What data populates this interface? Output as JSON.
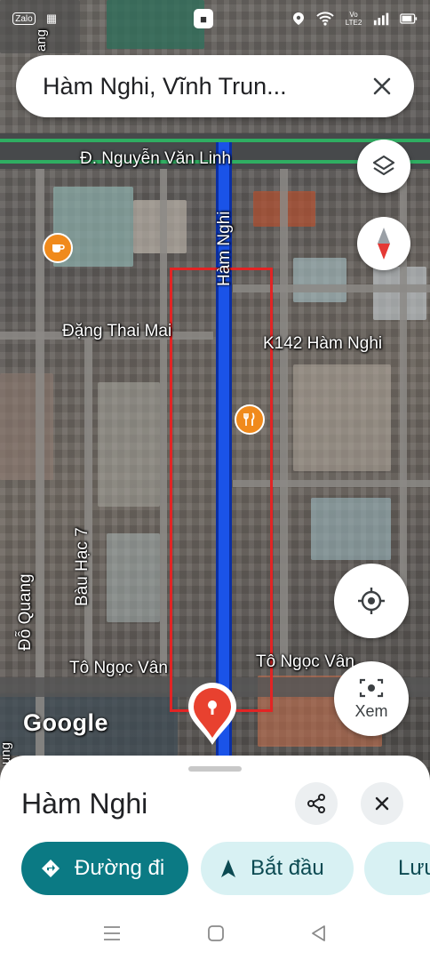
{
  "status_bar": {
    "left_icons": [
      "zalo-icon",
      "grid-icon",
      "bus-icon"
    ],
    "zalo_label": "Zalo",
    "right_icons": [
      "location-icon",
      "wifi-icon",
      "volte-icon",
      "signal-icon",
      "battery-icon"
    ],
    "volte_label": "Vo LTE2"
  },
  "search": {
    "value": "Hàm Nghi, Vĩnh Trun..."
  },
  "map": {
    "labels": {
      "main_road": "Đ. Nguyễn Văn Linh",
      "ham_nghi": "Hàm Nghi",
      "dang_thai_mai": "Đặng Thai Mai",
      "k142": "K142 Hàm Nghi",
      "bau_hac": "Bàu Hạc 7",
      "do_quang": "Đỗ Quang",
      "to_ngoc_van_left": "Tô Ngọc Vân",
      "to_ngoc_van_right": "Tô Ngọc Vân",
      "edge_top": "ang",
      "edge_bottom": "ung"
    },
    "google_logo": "Google",
    "route_color": "#1a53e8",
    "highlight_color": "#e32424",
    "poi_color": "#f08a1c"
  },
  "controls": {
    "layers_icon": "layers-icon",
    "compass_icon": "compass-icon",
    "locate_icon": "my-location-icon",
    "view_label": "Xem"
  },
  "sheet": {
    "title": "Hàm Nghi",
    "directions_label": "Đường đi",
    "start_label": "Bắt đầu",
    "save_label": "Lưu",
    "accent": "#0b7a84",
    "chip_bg": "#d8f1f3"
  }
}
